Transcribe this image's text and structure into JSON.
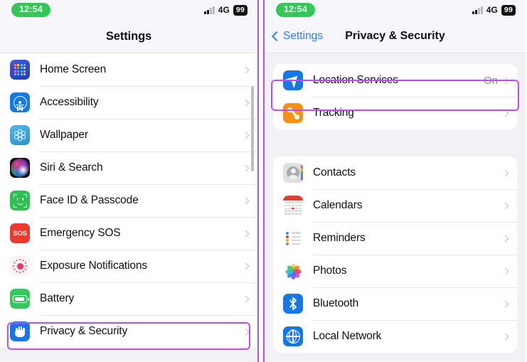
{
  "status": {
    "time": "12:54",
    "network": "4G",
    "battery": "99",
    "signal_icon": "cellular-bars-icon",
    "time_badge_color": "#33c759",
    "battery_badge_color": "#111111"
  },
  "highlight_color": "#bb4ef2",
  "left_panel": {
    "nav": {
      "title": "Settings"
    },
    "items": [
      {
        "label": "Home Screen",
        "icon": "home-screen-icon"
      },
      {
        "label": "Accessibility",
        "icon": "accessibility-icon"
      },
      {
        "label": "Wallpaper",
        "icon": "wallpaper-icon"
      },
      {
        "label": "Siri & Search",
        "icon": "siri-icon"
      },
      {
        "label": "Face ID & Passcode",
        "icon": "face-id-icon"
      },
      {
        "label": "Emergency SOS",
        "icon": "emergency-sos-icon"
      },
      {
        "label": "Exposure Notifications",
        "icon": "exposure-notifications-icon"
      },
      {
        "label": "Battery",
        "icon": "battery-icon"
      },
      {
        "label": "Privacy & Security",
        "icon": "privacy-hand-icon",
        "highlighted": true
      }
    ]
  },
  "right_panel": {
    "nav": {
      "back_label": "Settings",
      "title": "Privacy & Security",
      "back_icon": "chevron-left-icon",
      "back_color": "#2f7cf6"
    },
    "group1": [
      {
        "label": "Location Services",
        "value": "On",
        "icon": "location-services-icon",
        "highlighted": true
      },
      {
        "label": "Tracking",
        "value": "",
        "icon": "tracking-icon"
      }
    ],
    "group2": [
      {
        "label": "Contacts",
        "value": "",
        "icon": "contacts-icon"
      },
      {
        "label": "Calendars",
        "value": "",
        "icon": "calendars-icon"
      },
      {
        "label": "Reminders",
        "value": "",
        "icon": "reminders-icon"
      },
      {
        "label": "Photos",
        "value": "",
        "icon": "photos-icon"
      },
      {
        "label": "Bluetooth",
        "value": "",
        "icon": "bluetooth-icon"
      },
      {
        "label": "Local Network",
        "value": "",
        "icon": "local-network-icon"
      }
    ]
  }
}
